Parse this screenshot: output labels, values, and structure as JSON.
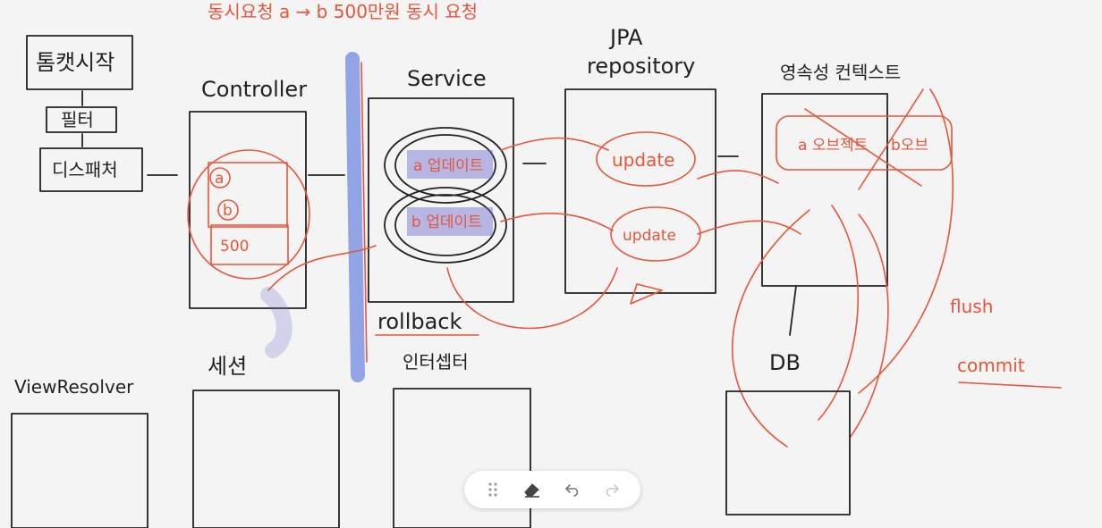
{
  "diagram": {
    "header_note": "동시요청 a → b 500만원 동시 요청",
    "boxes": {
      "start": "톰캣시작",
      "filter": "필터",
      "dispatcher": "디스패처",
      "controller": "Controller",
      "controller_items": [
        "a",
        "b",
        "500"
      ],
      "service": "Service",
      "service_items": [
        "a 업데이트",
        "b 업데이트"
      ],
      "jpa_line1": "JPA",
      "jpa_line2": "repository",
      "jpa_items": [
        "update",
        "update"
      ],
      "context": "영속성 컨텍스트",
      "context_items": [
        "a 오브젝트",
        "b오브"
      ],
      "view_resolver": "ViewResolver",
      "session": "세션",
      "interceptor": "인터셉터",
      "db": "DB"
    },
    "notes": {
      "rollback": "rollback",
      "flush": "flush",
      "commit": "commit"
    },
    "colors": {
      "ink": "#222222",
      "pen_red": "#e8553a",
      "highlighter_blue": "#3f63d8",
      "highlighter_purple": "#6a6ad0"
    }
  },
  "toolbar": {
    "icons": [
      "grip-icon",
      "eraser-icon",
      "undo-icon",
      "redo-icon"
    ]
  }
}
